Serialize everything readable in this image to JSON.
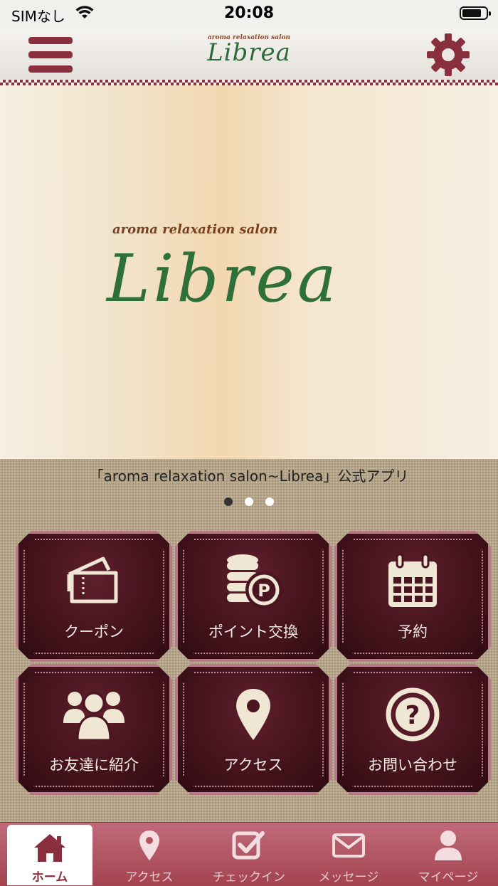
{
  "status_bar": {
    "carrier": "SIMなし",
    "time": "20:08"
  },
  "header": {
    "logo_sub": "aroma relaxation salon",
    "logo_main": "Librea",
    "menu_icon": "hamburger-menu-icon",
    "settings_icon": "gear-icon"
  },
  "hero": {
    "logo_sub": "aroma relaxation salon",
    "logo_main": "Librea"
  },
  "caption": "「aroma relaxation salon~Librea」公式アプリ",
  "carousel": {
    "pages": 3,
    "active_index": 0
  },
  "tiles": [
    {
      "label": "クーポン",
      "icon": "coupon-ticket-icon"
    },
    {
      "label": "ポイント交換",
      "icon": "point-coins-icon"
    },
    {
      "label": "予約",
      "icon": "calendar-icon"
    },
    {
      "label": "お友達に紹介",
      "icon": "friends-group-icon"
    },
    {
      "label": "アクセス",
      "icon": "map-pin-icon"
    },
    {
      "label": "お問い合わせ",
      "icon": "question-icon"
    }
  ],
  "tabbar": [
    {
      "label": "ホーム",
      "icon": "home-icon",
      "active": true
    },
    {
      "label": "アクセス",
      "icon": "map-pin-icon",
      "active": false
    },
    {
      "label": "チェックイン",
      "icon": "checkin-checkbox-icon",
      "active": false
    },
    {
      "label": "メッセージ",
      "icon": "envelope-icon",
      "active": false
    },
    {
      "label": "マイページ",
      "icon": "user-icon",
      "active": false
    }
  ],
  "colors": {
    "accent": "#8a2f3e",
    "tile_bg": "#3d1018",
    "tile_text": "#f4ece0",
    "logo_green": "#2e7038"
  }
}
